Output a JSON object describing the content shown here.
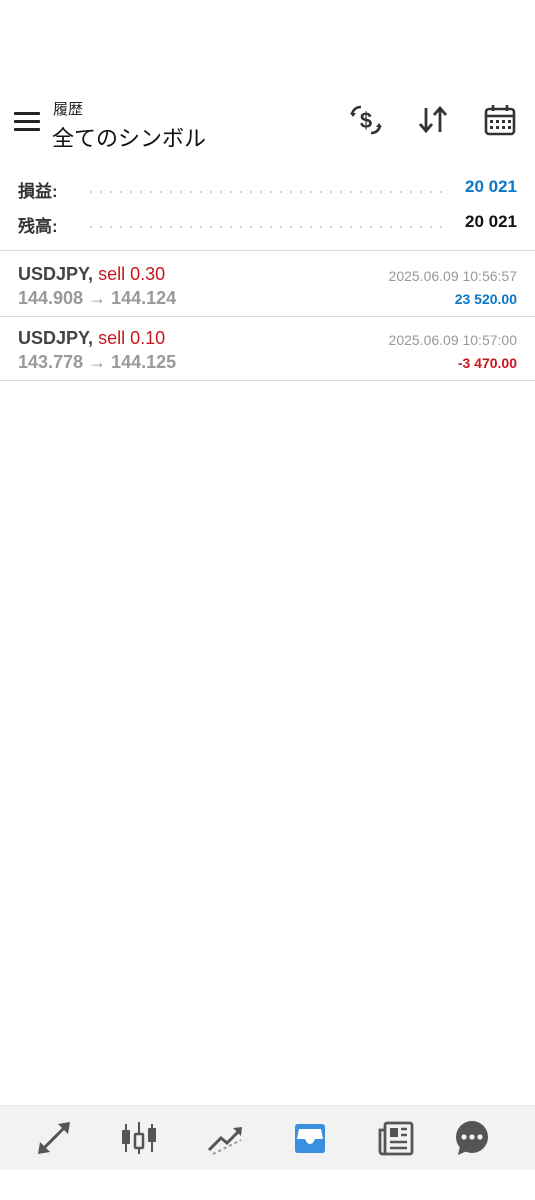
{
  "header": {
    "subtitle": "履歴",
    "title": "全てのシンボル"
  },
  "summary": {
    "profit_label": "損益:",
    "profit_value": "20 021",
    "balance_label": "残高:",
    "balance_value": "20 021"
  },
  "trades": [
    {
      "symbol": "USDJPY",
      "separator": ",",
      "side": "sell 0.30",
      "prices": "144.908 → 144.124",
      "time": "2025.06.09 10:56:57",
      "profit": "23 520.00"
    },
    {
      "symbol": "USDJPY",
      "separator": ",",
      "side": "sell 0.10",
      "prices": "143.778 → 144.125",
      "time": "2025.06.09 10:57:00",
      "profit": "-3 470.00"
    }
  ],
  "toolbar_icons": [
    "hamburger-menu-icon",
    "currency-exchange-icon",
    "sort-icon",
    "calendar-icon"
  ],
  "bottom_nav": [
    "quotes-icon",
    "chart-candles-icon",
    "trade-icon",
    "history-inbox-icon",
    "news-icon",
    "chat-icon"
  ],
  "colors": {
    "positive": "#0a78c8",
    "negative": "#c8171c",
    "active_nav": "#3a8fe0",
    "inactive_nav": "#555555"
  }
}
